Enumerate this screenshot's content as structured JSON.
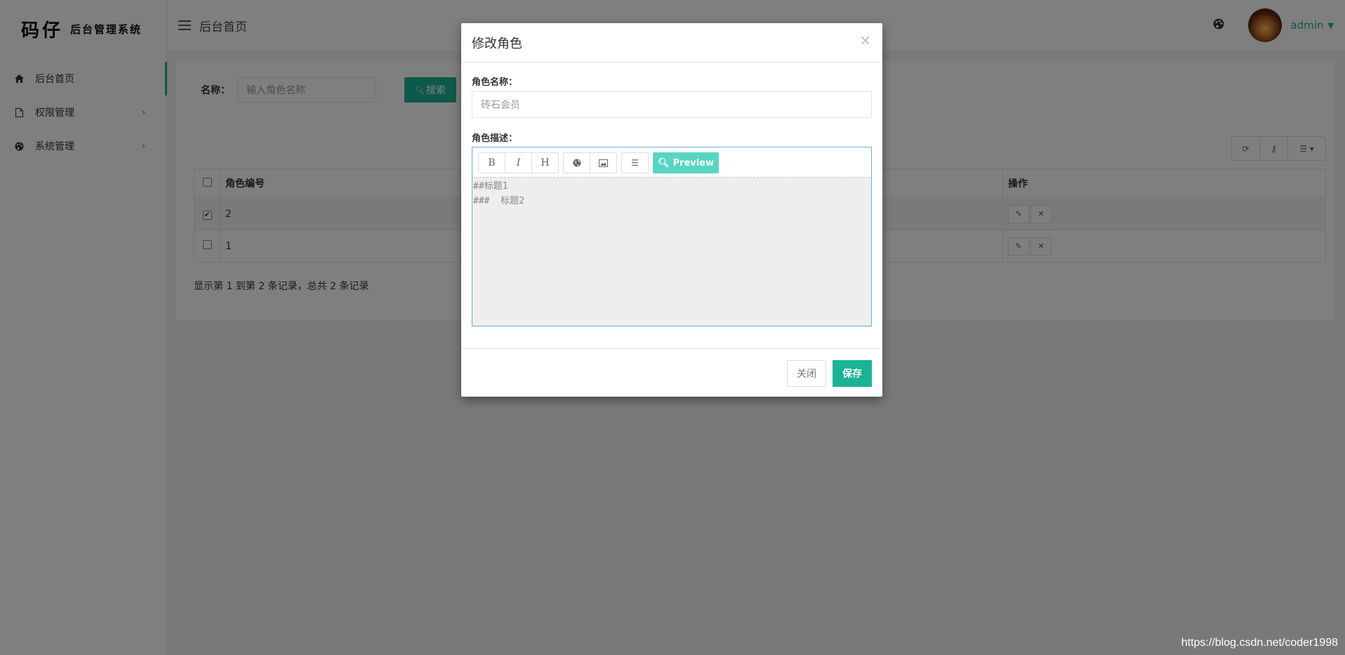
{
  "sidebar": {
    "logo_main": "码仔",
    "logo_sub": "后台管理系统",
    "items": [
      {
        "label": "后台首页",
        "icon": "home-icon"
      },
      {
        "label": "权限管理",
        "icon": "file-icon"
      },
      {
        "label": "系统管理",
        "icon": "palette-icon"
      }
    ]
  },
  "header": {
    "breadcrumb": "后台首页",
    "user_name": "admin"
  },
  "search": {
    "label": "名称：",
    "placeholder": "输入角色名称",
    "button_label": "搜索"
  },
  "table": {
    "headers": [
      "角色编号",
      "操作"
    ],
    "rows": [
      {
        "id": "2",
        "checked": true
      },
      {
        "id": "1",
        "checked": false
      }
    ],
    "summary": "显示第 1 到第 2 条记录，总共 2 条记录"
  },
  "modal": {
    "title": "修改角色",
    "close_symbol": "×",
    "name_label": "角色名称：",
    "name_value": "砖石会员",
    "desc_label": "角色描述：",
    "toolbar": {
      "bold": "B",
      "italic": "I",
      "heading": "H",
      "preview": "Preview"
    },
    "desc_content": "##标题1\n###  标题2",
    "close_button": "关闭",
    "save_button": "保存"
  },
  "watermark": "https://blog.csdn.net/coder1998",
  "colors": {
    "accent": "#1ab394",
    "preview": "#57d5c4"
  }
}
